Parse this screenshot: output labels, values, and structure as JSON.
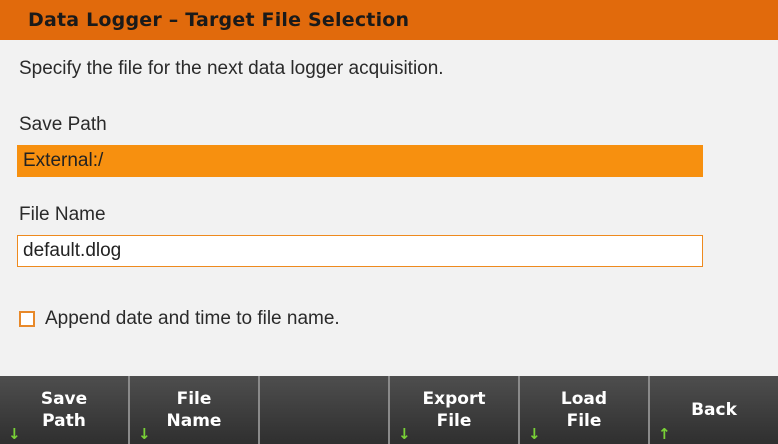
{
  "title": "Data Logger – Target File Selection",
  "instructions": "Specify the file for the next data logger acquisition.",
  "save_path": {
    "label": "Save Path",
    "value": "External:/"
  },
  "file_name": {
    "label": "File Name",
    "value": "default.dlog"
  },
  "append_option": {
    "label": "Append date and time to file name.",
    "checked": false
  },
  "softkeys": [
    {
      "line1": "Save",
      "line2": "Path",
      "arrow": "↓"
    },
    {
      "line1": "File",
      "line2": "Name",
      "arrow": "↓"
    },
    {
      "line1": "",
      "line2": "",
      "arrow": ""
    },
    {
      "line1": "Export",
      "line2": "File",
      "arrow": "↓"
    },
    {
      "line1": "Load",
      "line2": "File",
      "arrow": "↓"
    },
    {
      "line1": "Back",
      "line2": "",
      "arrow": "↑"
    }
  ],
  "colors": {
    "title_bar": "#e16a0c",
    "highlight": "#f7900f",
    "arrow": "#79d236"
  }
}
